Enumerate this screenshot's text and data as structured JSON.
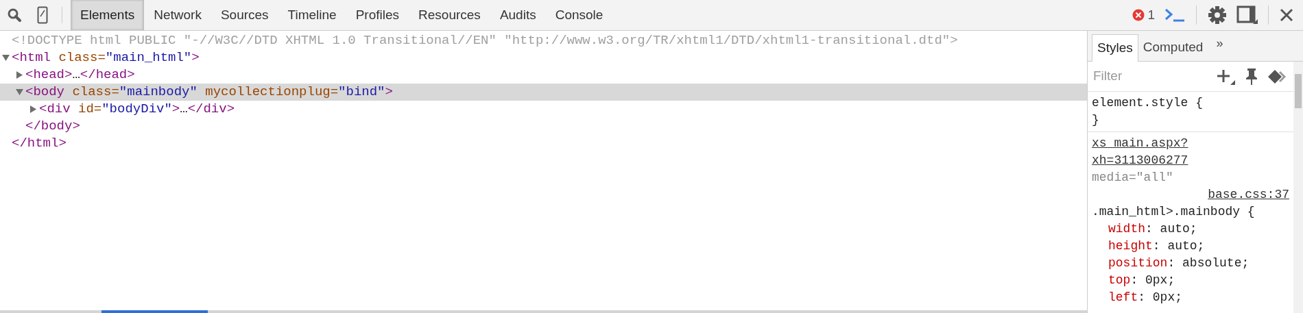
{
  "toolbar": {
    "tabs": [
      {
        "label": "Elements",
        "selected": true
      },
      {
        "label": "Network",
        "selected": false
      },
      {
        "label": "Sources",
        "selected": false
      },
      {
        "label": "Timeline",
        "selected": false
      },
      {
        "label": "Profiles",
        "selected": false
      },
      {
        "label": "Resources",
        "selected": false
      },
      {
        "label": "Audits",
        "selected": false
      },
      {
        "label": "Console",
        "selected": false
      }
    ],
    "error_count": "1"
  },
  "dom_tree": [
    {
      "kind": "doctype",
      "segments": [
        {
          "kind": "doctype",
          "text": "<!DOCTYPE html PUBLIC \"-//W3C//DTD XHTML 1.0 Transitional//EN\" \"http://www.w3.org/TR/xhtml1/DTD/xhtml1-transitional.dtd\">"
        }
      ]
    },
    {
      "kind": "element",
      "expanded": true,
      "selected": false,
      "segments": [
        {
          "kind": "tag",
          "text": "<html"
        },
        {
          "kind": "attr",
          "text": " class="
        },
        {
          "kind": "value",
          "text": "\"main_html\""
        },
        {
          "kind": "tag",
          "text": ">"
        }
      ],
      "children": [
        {
          "kind": "element",
          "expanded": false,
          "selected": false,
          "segments": [
            {
              "kind": "tag",
              "text": "<head>"
            },
            {
              "kind": "text",
              "text": "…"
            },
            {
              "kind": "tag",
              "text": "</head>"
            }
          ]
        },
        {
          "kind": "element",
          "expanded": true,
          "selected": true,
          "segments": [
            {
              "kind": "tag",
              "text": "<body"
            },
            {
              "kind": "attr",
              "text": " class="
            },
            {
              "kind": "value",
              "text": "\"mainbody\""
            },
            {
              "kind": "attr",
              "text": " mycollectionplug="
            },
            {
              "kind": "value",
              "text": "\"bind\""
            },
            {
              "kind": "tag",
              "text": ">"
            }
          ],
          "children": [
            {
              "kind": "element",
              "expanded": false,
              "selected": false,
              "segments": [
                {
                  "kind": "tag",
                  "text": "<div"
                },
                {
                  "kind": "attr",
                  "text": " id="
                },
                {
                  "kind": "value",
                  "text": "\"bodyDiv\""
                },
                {
                  "kind": "tag",
                  "text": ">"
                },
                {
                  "kind": "text",
                  "text": "…"
                },
                {
                  "kind": "tag",
                  "text": "</div>"
                }
              ]
            }
          ],
          "close": [
            {
              "kind": "tag",
              "text": "</body>"
            }
          ]
        }
      ],
      "close": [
        {
          "kind": "tag",
          "text": "</html>"
        }
      ]
    }
  ],
  "sidebar": {
    "tabs": [
      {
        "label": "Styles",
        "selected": true
      },
      {
        "label": "Computed",
        "selected": false
      }
    ],
    "more": "»",
    "filter": {
      "placeholder": "Filter"
    },
    "rules": [
      {
        "selector": "element.style {",
        "close": "}"
      },
      {
        "source_link": "xs_main.aspx?xh=3113006277",
        "media": "media=\"all\"",
        "file_link": "base.css:37",
        "selector": ".main_html>.mainbody {",
        "properties": [
          {
            "name": "width",
            "value": ": auto;"
          },
          {
            "name": "height",
            "value": ": auto;"
          },
          {
            "name": "position",
            "value": ": absolute;"
          },
          {
            "name": "top",
            "value": ": 0px;"
          },
          {
            "name": "left",
            "value": ": 0px;"
          }
        ]
      }
    ]
  }
}
